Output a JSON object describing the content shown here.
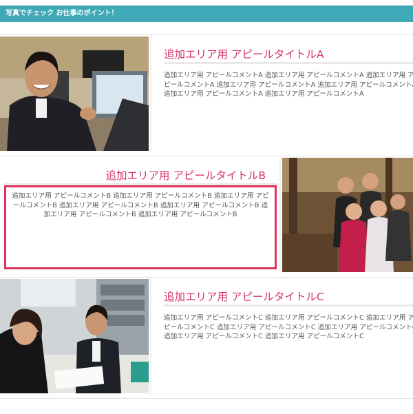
{
  "header": {
    "title": "写真でチェック お仕事のポイント！"
  },
  "sections": [
    {
      "title": "追加エリア用 アピールタイトルA",
      "comment": "追加エリア用 アピールコメントA 追加エリア用 アピールコメントA 追加エリア用 アピールコメントA 追加エリア用 アピールコメントA 追加エリア用 アピールコメントA 追加エリア用 アピールコメントA 追加エリア用 アピールコメントA"
    },
    {
      "title": "追加エリア用 アピールタイトルB",
      "comment": "追加エリア用 アピールコメントB 追加エリア用 アピールコメントB 追加エリア用 アピールコメントB 追加エリア用 アピールコメントB 追加エリア用 アピールコメントB 追加エリア用 アピールコメントB 追加エリア用 アピールコメントB"
    },
    {
      "title": "追加エリア用 アピールタイトルC",
      "comment": "追加エリア用 アピールコメントC 追加エリア用 アピールコメントC 追加エリア用 アピールコメントC 追加エリア用 アピールコメントC 追加エリア用 アピールコメントC 追加エリア用 アピールコメントC 追加エリア用 アピールコメントC"
    }
  ],
  "colors": {
    "header_bg": "#3fa9b8",
    "title_text": "#d6336c",
    "highlight_border": "#e0305b"
  }
}
